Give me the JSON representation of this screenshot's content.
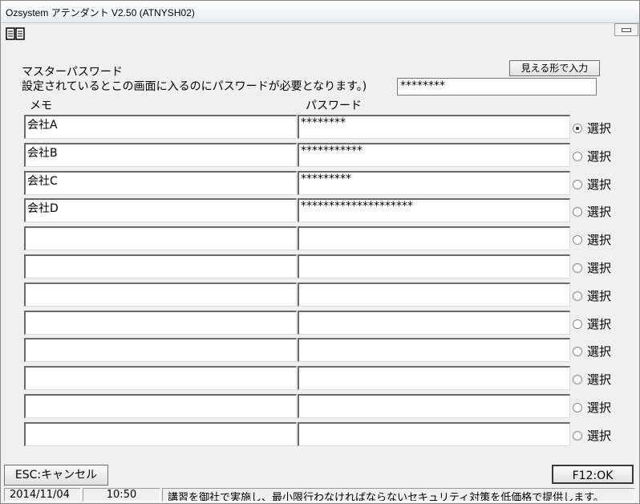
{
  "window": {
    "title": "Ozsystem アテンダント V2.50 (ATNYSH02)"
  },
  "header": {
    "master_password_label": "マスターパスワード",
    "description": "設定されているとこの画面に入るのにパスワードが必要となります。)",
    "show_button": "見える形で入力",
    "master_password_value": "********"
  },
  "columns": {
    "memo": "メモ",
    "password": "パスワード"
  },
  "rows": [
    {
      "memo": "会社A",
      "password": "********",
      "radio_label": "選択",
      "selected": true
    },
    {
      "memo": "会社B",
      "password": "***********",
      "radio_label": "選択",
      "selected": false
    },
    {
      "memo": "会社C",
      "password": "*********",
      "radio_label": "選択",
      "selected": false
    },
    {
      "memo": "会社D",
      "password": "********************",
      "radio_label": "選択",
      "selected": false
    },
    {
      "memo": "",
      "password": "",
      "radio_label": "選択",
      "selected": false
    },
    {
      "memo": "",
      "password": "",
      "radio_label": "選択",
      "selected": false
    },
    {
      "memo": "",
      "password": "",
      "radio_label": "選択",
      "selected": false
    },
    {
      "memo": "",
      "password": "",
      "radio_label": "選択",
      "selected": false
    },
    {
      "memo": "",
      "password": "",
      "radio_label": "選択",
      "selected": false
    },
    {
      "memo": "",
      "password": "",
      "radio_label": "選択",
      "selected": false
    },
    {
      "memo": "",
      "password": "",
      "radio_label": "選択",
      "selected": false
    },
    {
      "memo": "",
      "password": "",
      "radio_label": "選択",
      "selected": false
    }
  ],
  "footer": {
    "cancel_button": "ESC:キャンセル",
    "ok_button": "F12:OK"
  },
  "statusbar": {
    "date": "2014/11/04",
    "time": "10:50",
    "message": "講習を御社で実施し、最小限行わなければならないセキュリティ対策を低価格で提供します。"
  }
}
